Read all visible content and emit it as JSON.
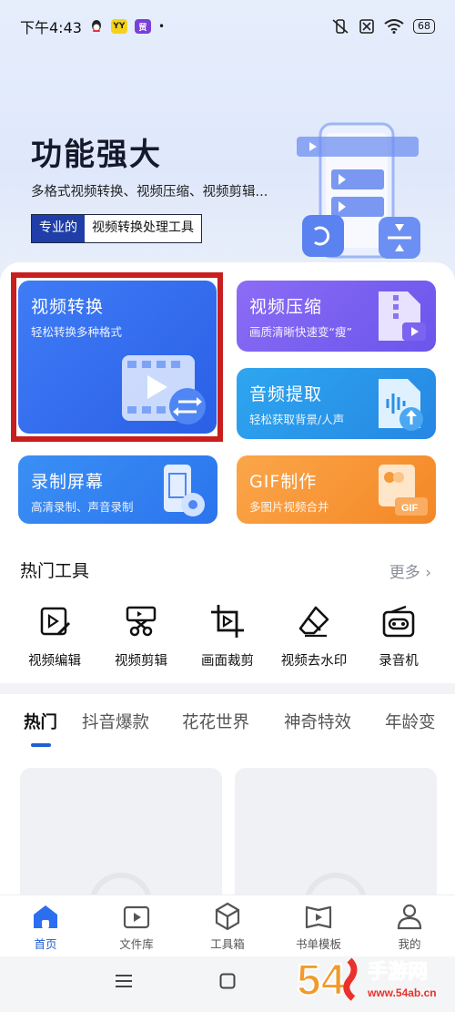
{
  "status_bar": {
    "time": "下午4:43",
    "battery": "68",
    "app_icon_1_text": "YY",
    "app_icon_2_text": "贸"
  },
  "hero": {
    "title": "功能强大",
    "subtitle": "多格式视频转换、视频压缩、视频剪辑...",
    "tag_primary": "专业的",
    "tag_secondary": "视频转换处理工具"
  },
  "feature_cards": [
    {
      "title": "视频转换",
      "subtitle": "轻松转换多种格式"
    },
    {
      "title": "视频压缩",
      "subtitle": "画质清晰快速变“瘦”"
    },
    {
      "title": "音频提取",
      "subtitle": "轻松获取背景/人声"
    },
    {
      "title": "录制屏幕",
      "subtitle": "高清录制、声音录制"
    },
    {
      "title": "GIF制作",
      "subtitle": "多图片视频合并",
      "badge": "GIF"
    }
  ],
  "hot_tools": {
    "heading": "热门工具",
    "more": "更多 ›",
    "items": [
      {
        "label": "视频编辑",
        "icon": "video-edit-icon"
      },
      {
        "label": "视频剪辑",
        "icon": "scissors-icon"
      },
      {
        "label": "画面裁剪",
        "icon": "crop-icon"
      },
      {
        "label": "视频去水印",
        "icon": "eraser-icon"
      },
      {
        "label": "录音机",
        "icon": "recorder-icon"
      }
    ]
  },
  "feed_tabs": [
    "热门",
    "抖音爆款",
    "花花世界",
    "神奇特效",
    "年龄变"
  ],
  "bottom_nav": [
    {
      "label": "首页",
      "icon": "home-icon",
      "active": true
    },
    {
      "label": "文件库",
      "icon": "folder-icon"
    },
    {
      "label": "工具箱",
      "icon": "toolbox-icon"
    },
    {
      "label": "书单模板",
      "icon": "template-icon"
    },
    {
      "label": "我的",
      "icon": "profile-icon"
    }
  ],
  "watermark": {
    "brand": "54",
    "site": "手游网",
    "url": "www.54ab.cn"
  },
  "colors": {
    "primary": "#1f5fd8",
    "card_convert": "#2f6ff0",
    "card_compress": "#7b5ff0",
    "card_audio": "#2596e8",
    "card_record": "#2b84f0",
    "card_gif": "#f58f2e",
    "highlight": "#c81e1e"
  }
}
